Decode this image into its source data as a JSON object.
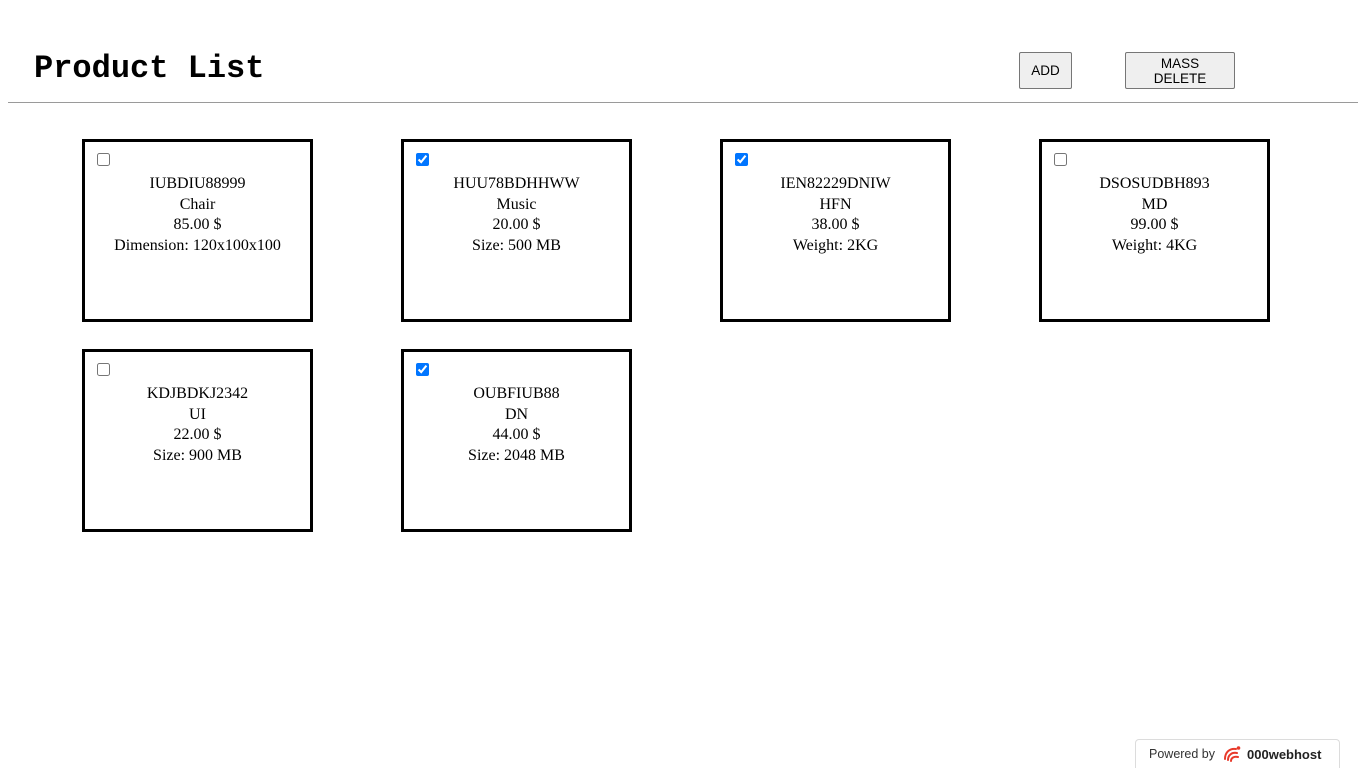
{
  "header": {
    "title": "Product List",
    "add_label": "ADD",
    "mass_delete_label": "MASS DELETE"
  },
  "products": [
    {
      "sku": "IUBDIU88999",
      "name": "Chair",
      "price": "85.00 $",
      "attribute": "Dimension: 120x100x100",
      "checked": false
    },
    {
      "sku": "HUU78BDHHWW",
      "name": "Music",
      "price": "20.00 $",
      "attribute": "Size: 500 MB",
      "checked": true
    },
    {
      "sku": "IEN82229DNIW",
      "name": "HFN",
      "price": "38.00 $",
      "attribute": "Weight: 2KG",
      "checked": true
    },
    {
      "sku": "DSOSUDBH893",
      "name": "MD",
      "price": "99.00 $",
      "attribute": "Weight: 4KG",
      "checked": false
    },
    {
      "sku": "KDJBDKJ2342",
      "name": "UI",
      "price": "22.00 $",
      "attribute": "Size: 900 MB",
      "checked": false
    },
    {
      "sku": "OUBFIUB88",
      "name": "DN",
      "price": "44.00 $",
      "attribute": "Size: 2048 MB",
      "checked": true
    }
  ],
  "footer": {
    "powered_by": "Powered by",
    "brand": "000webhost",
    "logo_icon": "000webhost-logo-icon",
    "brand_color": "#e8392a"
  },
  "colors": {
    "checkbox_accent": "#0075ff"
  }
}
